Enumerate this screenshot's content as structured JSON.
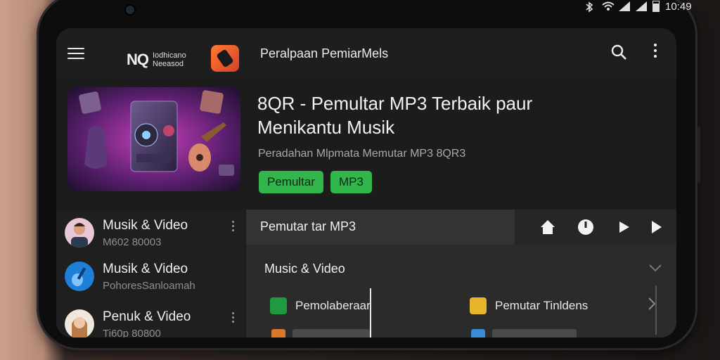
{
  "status_bar": {
    "time": "10:49"
  },
  "app_bar": {
    "brand_mark": "NQ",
    "brand_line1": "Iodhicano",
    "brand_line2": "Neeasod",
    "heading": "Peralpaan PemiarMels"
  },
  "hero": {
    "title": "8QR - Pemultar MP3 Terbaik paur Menikantu Musik",
    "subtitle": "Peradahan Mlpmata Memutar MP3 8QR3",
    "tags": [
      "Pemultar",
      "MP3"
    ]
  },
  "list": [
    {
      "title": "Musik & Video",
      "subtitle": "M602 80003"
    },
    {
      "title": "Musik & Video",
      "subtitle": "PohoresSanloamah"
    },
    {
      "title": "Penuk & Video",
      "subtitle": "Ti60p 80800"
    }
  ],
  "player": {
    "title": "Pemutar tar MP3",
    "controls": [
      "home-icon",
      "power-icon",
      "play-icon",
      "next-icon"
    ]
  },
  "panel": {
    "section_title": "Music & Video",
    "items": [
      {
        "label": "Pemolaberaar",
        "icon": "grid-icon",
        "color": "#1f9a3e"
      },
      {
        "label": "Pemutar Tinldens",
        "icon": "app-icon",
        "color": "#e6b52a"
      }
    ]
  },
  "colors": {
    "accent_green": "#32b54a",
    "logo_orange": "#ff7a2e",
    "background": "#1c1c1d"
  }
}
